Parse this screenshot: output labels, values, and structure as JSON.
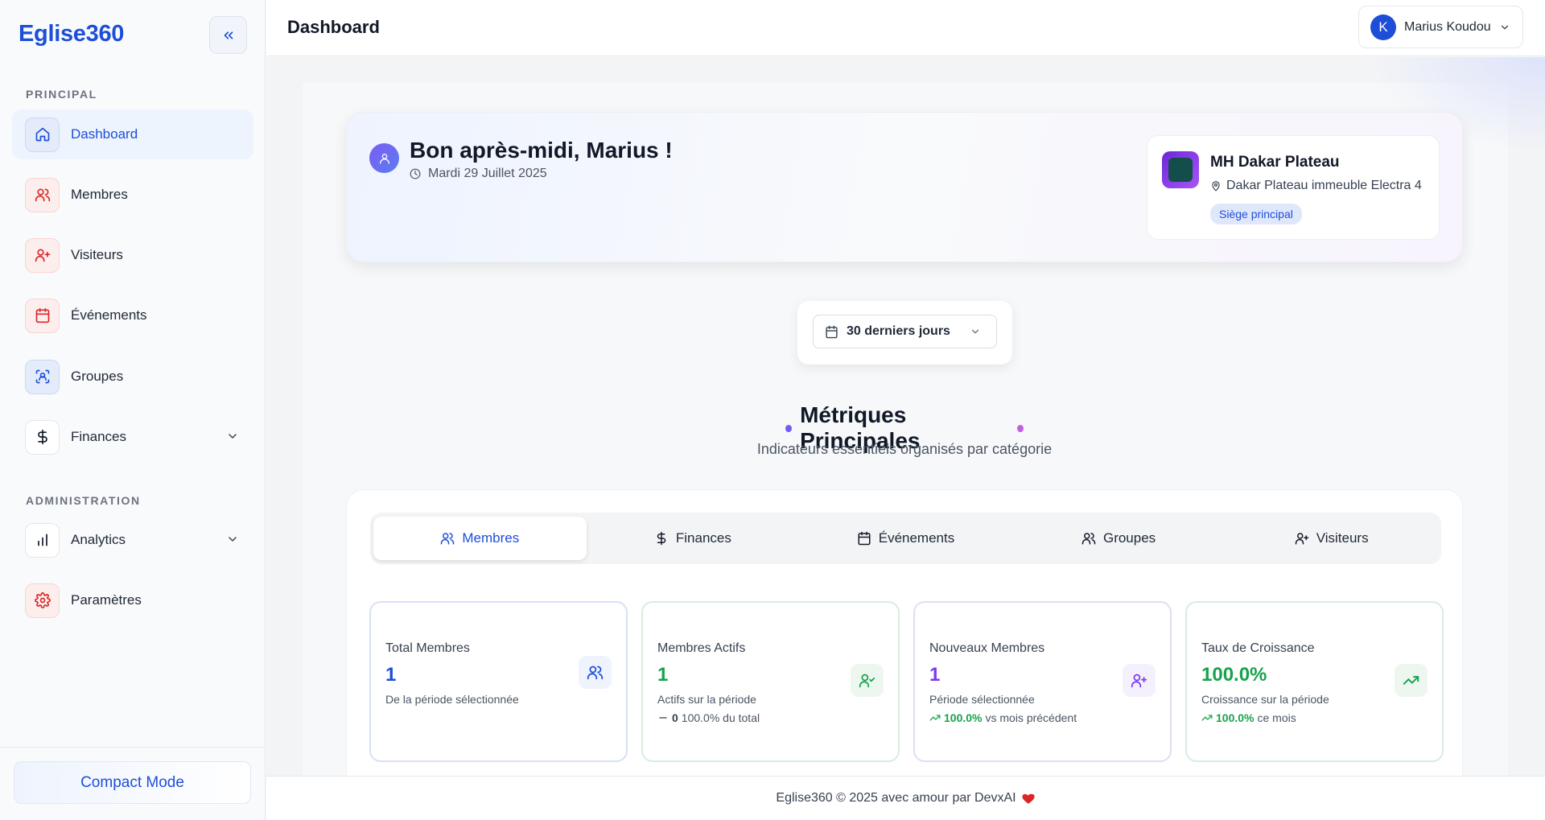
{
  "sidebar": {
    "brand": "Eglise360",
    "sections": {
      "principal": "PRINCIPAL",
      "administration": "ADMINISTRATION"
    },
    "items": [
      {
        "label": "Dashboard",
        "icon": "home-icon"
      },
      {
        "label": "Membres",
        "icon": "users-icon"
      },
      {
        "label": "Visiteurs",
        "icon": "user-plus-icon"
      },
      {
        "label": "Événements",
        "icon": "calendar-icon"
      },
      {
        "label": "Groupes",
        "icon": "group-scan-icon"
      },
      {
        "label": "Finances",
        "icon": "dollar-icon"
      },
      {
        "label": "Analytics",
        "icon": "bar-chart-icon"
      },
      {
        "label": "Paramètres",
        "icon": "gear-icon"
      }
    ],
    "compact_mode": "Compact Mode"
  },
  "header": {
    "title": "Dashboard",
    "user": {
      "initial": "K",
      "name": "Marius Koudou"
    }
  },
  "greeting": {
    "title": "Bon après-midi, Marius !",
    "date": "Mardi 29 Juillet 2025"
  },
  "church": {
    "name": "MH Dakar Plateau",
    "address": "Dakar Plateau immeuble Electra 4",
    "badge": "Siège principal"
  },
  "period": {
    "selected": "30 derniers jours"
  },
  "metrics": {
    "title": "Métriques Principales",
    "subtitle": "Indicateurs essentiels organisés par catégorie",
    "tabs": [
      "Membres",
      "Finances",
      "Événements",
      "Groupes",
      "Visiteurs"
    ],
    "cards": [
      {
        "label": "Total Membres",
        "value": "1",
        "desc": "De la période sélectionnée",
        "color": "#1d4ed8"
      },
      {
        "label": "Membres Actifs",
        "value": "1",
        "desc": "Actifs sur la période",
        "trend_value": "0",
        "trend_text": "100.0% du total",
        "color": "#16a34a"
      },
      {
        "label": "Nouveaux Membres",
        "value": "1",
        "desc": "Période sélectionnée",
        "trend_value": "100.0%",
        "trend_text": "vs mois précédent",
        "color": "#7c3aed"
      },
      {
        "label": "Taux de Croissance",
        "value": "100.0%",
        "desc": "Croissance sur la période",
        "trend_value": "100.0%",
        "trend_text": "ce mois",
        "color": "#16a34a"
      }
    ]
  },
  "footer": {
    "text": "Eglise360 © 2025 avec amour par DevxAI"
  },
  "colors": {
    "accent": "#1d4ed8",
    "success": "#16a34a",
    "purple": "#7c3aed",
    "danger": "#dc2626"
  }
}
